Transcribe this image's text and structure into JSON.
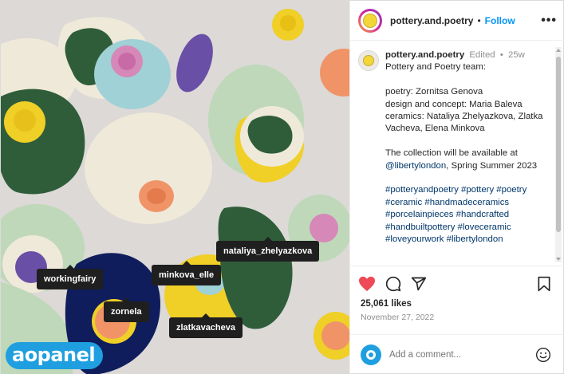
{
  "post": {
    "username": "pottery.and.poetry",
    "separator": "•",
    "follow_label": "Follow",
    "more_label": "•••"
  },
  "photo": {
    "tags": [
      "nataliya_zhelyazkova",
      "workingfairy",
      "minkova_elle",
      "zornela",
      "zlatkavacheva"
    ],
    "watermark": "aopanel",
    "colors": {
      "background": "#d9d6d3",
      "green": "#2f5d3a",
      "cream": "#efe9da",
      "yellow": "#f0cf27",
      "navy": "#0f1d5c",
      "purple": "#6a4fa6",
      "mint": "#bfd8b9",
      "pink": "#d688b8",
      "peach": "#f09468"
    }
  },
  "caption": {
    "username": "pottery.and.poetry",
    "edited": "Edited",
    "dot": "•",
    "age": "25w",
    "lines": [
      "Pottery and Poetry team:",
      "",
      "poetry: Zornitsa Genova",
      "design and concept: Maria Baleva",
      "ceramics: Nataliya Zhelyazkova, Zlatka",
      "Vacheva, Elena Minkova",
      "",
      "The collection will be available at"
    ],
    "mention": "@libertylondon",
    "mention_suffix": ", Spring Summer 2023",
    "hashtag_lines": [
      "#potteryandpoetry #pottery #poetry",
      "#ceramic #handmadeceramics",
      "#porcelainpieces #handcrafted",
      "#handbuiltpottery #loveceramic",
      "#loveyourwork #libertylondon"
    ]
  },
  "actions": {
    "like_icon": "heart-filled-icon",
    "comment_icon": "comment-icon",
    "share_icon": "share-icon",
    "save_icon": "bookmark-icon",
    "like_color": "#ed4956"
  },
  "likes": "25,061 likes",
  "date": "November 27, 2022",
  "comment_box": {
    "placeholder": "Add a comment...",
    "emoji_icon": "smiley-icon"
  }
}
